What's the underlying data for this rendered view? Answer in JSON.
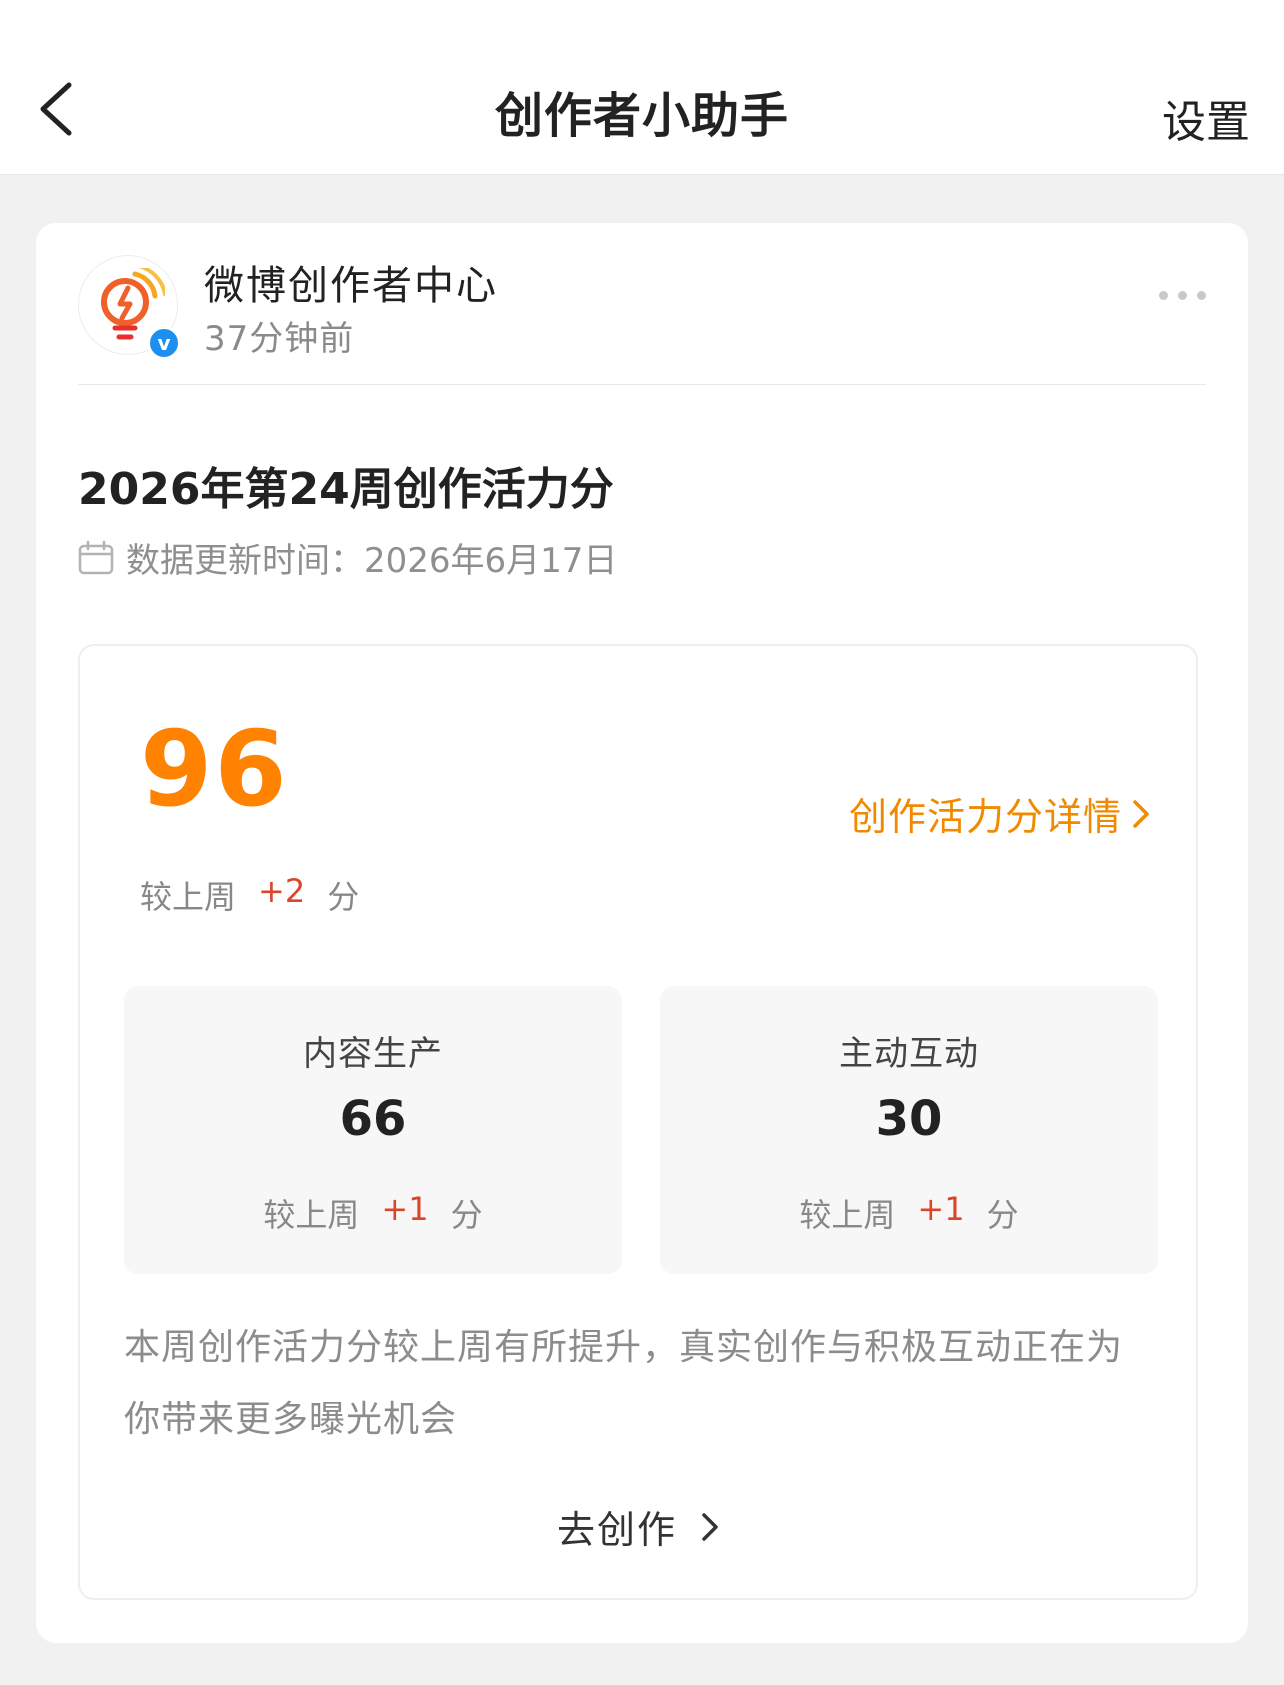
{
  "nav": {
    "title": "创作者小助手",
    "settings_label": "设置"
  },
  "post": {
    "source_name": "微博创作者中心",
    "time_ago": "37分钟前",
    "title": "2026年第24周创作活力分",
    "update_label": "数据更新时间：",
    "update_date": "2026年6月17日"
  },
  "score": {
    "total": "96",
    "detail_link_label": "创作活力分详情",
    "week_prefix": "较上周",
    "week_delta": "+2",
    "week_suffix": "分",
    "subscores": [
      {
        "label": "内容生产",
        "value": "66",
        "prefix": "较上周",
        "delta": "+1",
        "suffix": "分"
      },
      {
        "label": "主动互动",
        "value": "30",
        "prefix": "较上周",
        "delta": "+1",
        "suffix": "分"
      }
    ],
    "summary": "本周创作活力分较上周有所提升，真实创作与积极互动正在为你带来更多曝光机会",
    "cta_label": "去创作"
  },
  "colors": {
    "accent_orange": "#ff8200",
    "link_orange": "#f08a00",
    "delta_red": "#d9462b",
    "verified_blue": "#1d8ff0"
  },
  "icons": {
    "back": "chevron-left-icon",
    "more": "more-dots-icon",
    "calendar": "calendar-icon",
    "detail_arrow": "chevron-right-icon",
    "cta_arrow": "chevron-right-icon",
    "verified": "verified-badge-icon",
    "avatar_logo": "lightbulb-lightning-logo"
  },
  "verified_letter": "v"
}
